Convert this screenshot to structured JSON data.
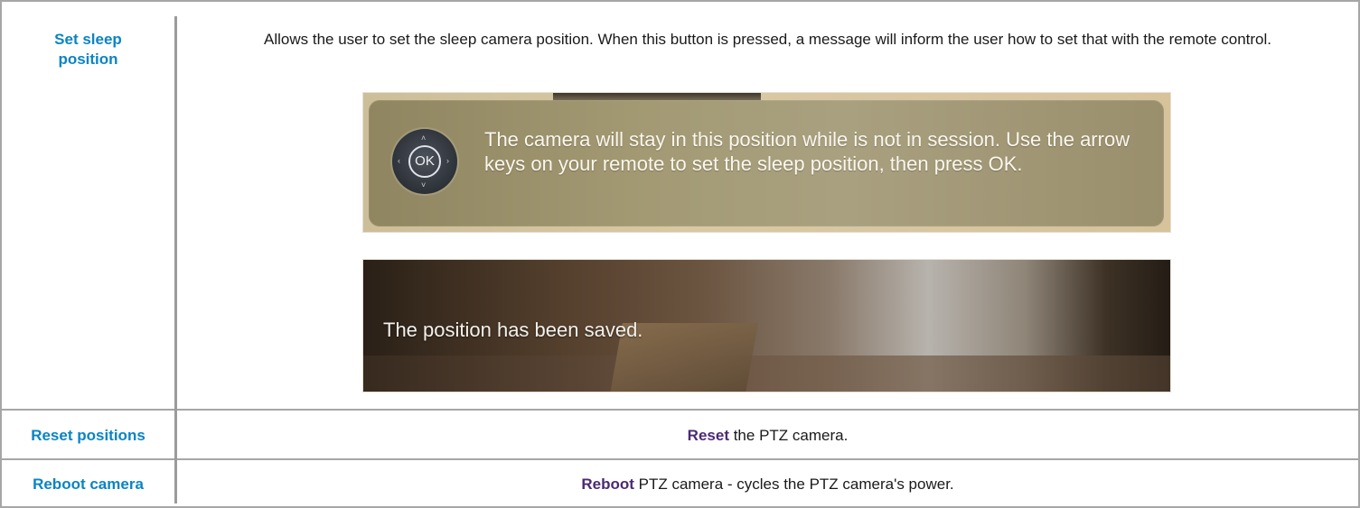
{
  "rows": [
    {
      "term": "Set sleep position",
      "description": "Allows the user to set the sleep camera position. When this button is pressed, a message will inform the user how to set that with the remote control.",
      "screenshot_1": {
        "ok_label": "OK",
        "message": "The camera will stay in this position while is not in session. Use the arrow keys on your remote to set the sleep position, then press OK.",
        "icon": "remote-dpad-icon"
      },
      "screenshot_2": {
        "message": "The position has been saved."
      }
    },
    {
      "term": "Reset positions",
      "keyword": "Reset",
      "description_rest": " the PTZ camera."
    },
    {
      "term": "Reboot camera",
      "keyword": "Reboot",
      "description_rest": " PTZ camera - cycles the PTZ camera's power."
    }
  ],
  "colors": {
    "term_link": "#0a84c4",
    "keyword": "#4b2a72",
    "border": "#a6a6a6"
  }
}
